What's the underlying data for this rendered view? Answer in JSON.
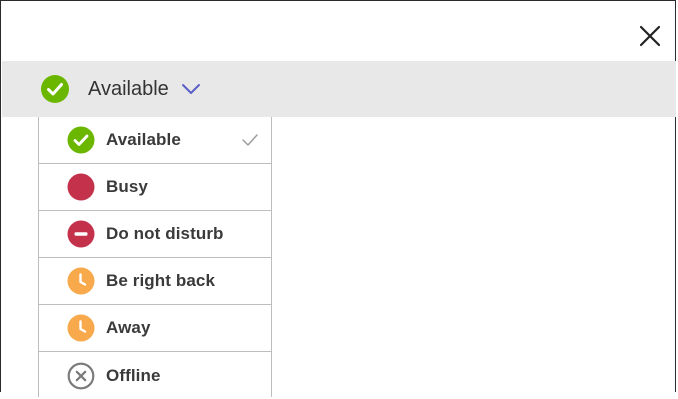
{
  "window": {
    "close_icon": "close-icon"
  },
  "status": {
    "current_label": "Available",
    "current_icon": "available-check-icon",
    "chevron_icon": "chevron-down-icon"
  },
  "menu": {
    "items": [
      {
        "label": "Available",
        "icon": "available-check-icon",
        "selected": true,
        "color": "#6bb700"
      },
      {
        "label": "Busy",
        "icon": "busy-dot-icon",
        "selected": false,
        "color": "#c4314b"
      },
      {
        "label": "Do not disturb",
        "icon": "do-not-disturb-icon",
        "selected": false,
        "color": "#c4314b"
      },
      {
        "label": "Be right back",
        "icon": "clock-icon",
        "selected": false,
        "color": "#f8a94b"
      },
      {
        "label": "Away",
        "icon": "clock-icon",
        "selected": false,
        "color": "#f8a94b"
      },
      {
        "label": "Offline",
        "icon": "offline-x-icon",
        "selected": false,
        "color": "#8a8a8a"
      }
    ]
  },
  "colors": {
    "available": "#6bb700",
    "busy": "#c4314b",
    "away": "#f8a94b",
    "offline": "#8a8a8a",
    "bar_background": "#e8e8e8"
  }
}
